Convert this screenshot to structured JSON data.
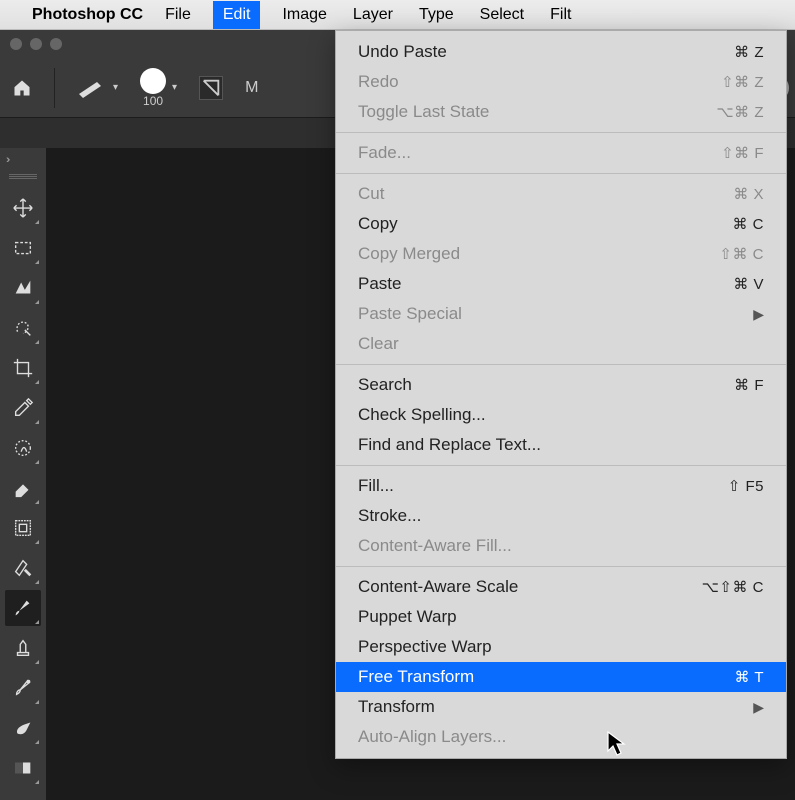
{
  "menubar": {
    "app": "Photoshop CC",
    "items": [
      "File",
      "Edit",
      "Image",
      "Layer",
      "Type",
      "Select",
      "Filt"
    ],
    "active_index": 1
  },
  "options_bar": {
    "size_label": "100",
    "mode_prefix": "M"
  },
  "tools": [
    {
      "name": "move-tool"
    },
    {
      "name": "marquee-tool"
    },
    {
      "name": "lasso-tool"
    },
    {
      "name": "quick-select-tool"
    },
    {
      "name": "crop-tool"
    },
    {
      "name": "eyedropper-tool"
    },
    {
      "name": "healing-brush-tool"
    },
    {
      "name": "eraser-tool"
    },
    {
      "name": "frame-tool"
    },
    {
      "name": "history-brush-tool"
    },
    {
      "name": "brush-tool",
      "selected": true
    },
    {
      "name": "clone-stamp-tool"
    },
    {
      "name": "mixer-brush-tool"
    },
    {
      "name": "smudge-tool"
    },
    {
      "name": "gradient-tool"
    }
  ],
  "edit_menu": [
    {
      "label": "Undo Paste",
      "shortcut": "⌘ Z"
    },
    {
      "label": "Redo",
      "shortcut": "⇧⌘ Z",
      "disabled": true
    },
    {
      "label": "Toggle Last State",
      "shortcut": "⌥⌘ Z",
      "disabled": true
    },
    {
      "sep": true
    },
    {
      "label": "Fade...",
      "shortcut": "⇧⌘ F",
      "disabled": true
    },
    {
      "sep": true
    },
    {
      "label": "Cut",
      "shortcut": "⌘ X",
      "disabled": true
    },
    {
      "label": "Copy",
      "shortcut": "⌘ C"
    },
    {
      "label": "Copy Merged",
      "shortcut": "⇧⌘ C",
      "disabled": true
    },
    {
      "label": "Paste",
      "shortcut": "⌘ V"
    },
    {
      "label": "Paste Special",
      "submenu": true,
      "disabled": true
    },
    {
      "label": "Clear",
      "disabled": true
    },
    {
      "sep": true
    },
    {
      "label": "Search",
      "shortcut": "⌘ F"
    },
    {
      "label": "Check Spelling..."
    },
    {
      "label": "Find and Replace Text..."
    },
    {
      "sep": true
    },
    {
      "label": "Fill...",
      "shortcut": "⇧ F5"
    },
    {
      "label": "Stroke..."
    },
    {
      "label": "Content-Aware Fill...",
      "disabled": true
    },
    {
      "sep": true
    },
    {
      "label": "Content-Aware Scale",
      "shortcut": "⌥⇧⌘ C"
    },
    {
      "label": "Puppet Warp"
    },
    {
      "label": "Perspective Warp"
    },
    {
      "label": "Free Transform",
      "shortcut": "⌘ T",
      "highlight": true
    },
    {
      "label": "Transform",
      "submenu": true
    },
    {
      "label": "Auto-Align Layers...",
      "disabled": true
    }
  ]
}
